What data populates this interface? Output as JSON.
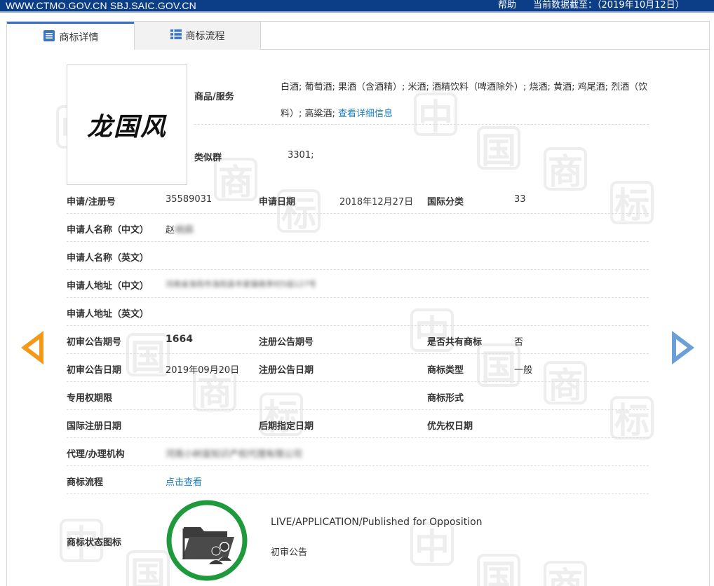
{
  "topbar": {
    "sites": "WWW.CTMO.GOV.CN SBJ.SAIC.GOV.CN",
    "help": "帮助",
    "data_date": "当前数据截至：（2019年10月12日）"
  },
  "tabs": [
    {
      "label": "商标详情",
      "icon": "document-list-icon",
      "active": true
    },
    {
      "label": "商标流程",
      "icon": "grid-list-icon",
      "active": false
    }
  ],
  "trademark": {
    "mark_text": "龙国风",
    "goods_label": "商品/服务",
    "goods_value": "白酒; 葡萄酒; 果酒（含酒精）; 米酒; 酒精饮料（啤酒除外）; 烧酒; 黄酒; 鸡尾酒; 烈酒（饮料）; 高粱酒;",
    "goods_link": "查看详细信息",
    "similar_group_label": "类似群",
    "similar_group_value": "3301;"
  },
  "fields": {
    "reg_no_label": "申请/注册号",
    "reg_no": "35589031",
    "app_date_label": "申请日期",
    "app_date": "2018年12月27日",
    "intl_class_label": "国际分类",
    "intl_class": "33",
    "applicant_cn_label": "申请人名称（中文）",
    "applicant_cn": "赵桃蒜",
    "applicant_en_label": "申请人名称（英文）",
    "applicant_en": "",
    "address_cn_label": "申请人地址（中文）",
    "address_cn": "河南省洛阳市洛阳县辛家镇南李村5组127号",
    "address_en_label": "申请人地址（英文）",
    "address_en": "",
    "prelim_issue_label": "初审公告期号",
    "prelim_issue": "1664",
    "reg_issue_label": "注册公告期号",
    "reg_issue": "",
    "shared_label": "是否共有商标",
    "shared": "否",
    "prelim_date_label": "初审公告日期",
    "prelim_date": "2019年09月20日",
    "reg_date_label": "注册公告日期",
    "reg_date": "",
    "mark_type_label": "商标类型",
    "mark_type": "一般",
    "exclusive_period_label": "专用权期限",
    "exclusive_period": "",
    "mark_form_label": "商标形式",
    "mark_form": "",
    "intl_reg_date_label": "国际注册日期",
    "intl_reg_date": "",
    "later_designation_label": "后期指定日期",
    "later_designation": "",
    "priority_date_label": "优先权日期",
    "priority_date": "",
    "agent_label": "代理/办理机构",
    "agent": "河南小树苗知识产权代理有限公司",
    "process_label": "商标流程",
    "process_link": "点击查看",
    "status_icon_label": "商标状态图标",
    "status_en": "LIVE/APPLICATION/Published for Opposition",
    "status_cn": "初审公告"
  },
  "watermark": [
    "中",
    "国",
    "商",
    "标"
  ],
  "colors": {
    "topbar": "#0b3e86",
    "link": "#1a7fc7",
    "arrow_prev": "#f39a1a",
    "arrow_next": "#6a9fd8",
    "status_ring": "#1e9a3c"
  }
}
